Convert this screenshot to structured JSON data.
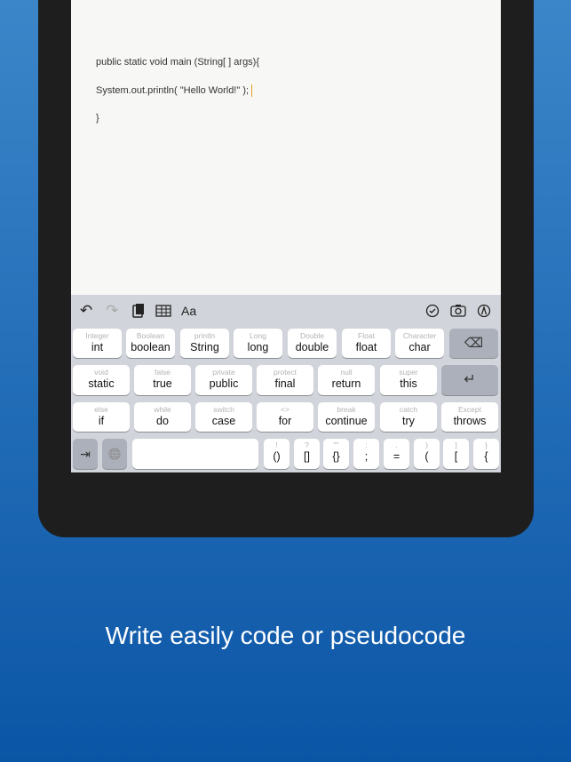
{
  "editor": {
    "lines": [
      "public static void main (String[ ] args){",
      "System.out.println( \"Hello World!\" );",
      "}"
    ]
  },
  "toolbar": {
    "undo": "↶",
    "redo": "↷",
    "font": "Aa"
  },
  "keyboard": {
    "row1": [
      {
        "s": "Integer",
        "m": "int"
      },
      {
        "s": "Boolean",
        "m": "boolean"
      },
      {
        "s": "println",
        "m": "String"
      },
      {
        "s": "Long",
        "m": "long"
      },
      {
        "s": "Double",
        "m": "double"
      },
      {
        "s": "Float",
        "m": "float"
      },
      {
        "s": "Character",
        "m": "char"
      }
    ],
    "row2": [
      {
        "s": "void",
        "m": "static"
      },
      {
        "s": "false",
        "m": "true"
      },
      {
        "s": "private",
        "m": "public"
      },
      {
        "s": "protect",
        "m": "final"
      },
      {
        "s": "null",
        "m": "return"
      },
      {
        "s": "super",
        "m": "this"
      }
    ],
    "row3": [
      {
        "s": "else",
        "m": "if"
      },
      {
        "s": "while",
        "m": "do"
      },
      {
        "s": "switch",
        "m": "case"
      },
      {
        "s": "<>",
        "m": "for"
      },
      {
        "s": "break",
        "m": "continue"
      },
      {
        "s": "catch",
        "m": "try"
      },
      {
        "s": "Except",
        "m": "throws"
      }
    ],
    "row4": [
      {
        "s": "!",
        "m": "()"
      },
      {
        "s": "?",
        "m": "[]"
      },
      {
        "s": "\"\"",
        "m": "{}"
      },
      {
        "s": ":",
        "m": ";"
      },
      {
        "s": ".",
        "m": "="
      },
      {
        "s": ")",
        "m": "("
      },
      {
        "s": "]",
        "m": "["
      },
      {
        "s": "}",
        "m": "{"
      }
    ],
    "backspace": "⌫",
    "enter": "↵",
    "tab": "⇥",
    "globe": "🌐"
  },
  "caption": "Write easily code or pseudocode",
  "colors": {
    "cursor": "#e8a020",
    "background_top": "#3b86c9",
    "background_bottom": "#0b55a6"
  }
}
